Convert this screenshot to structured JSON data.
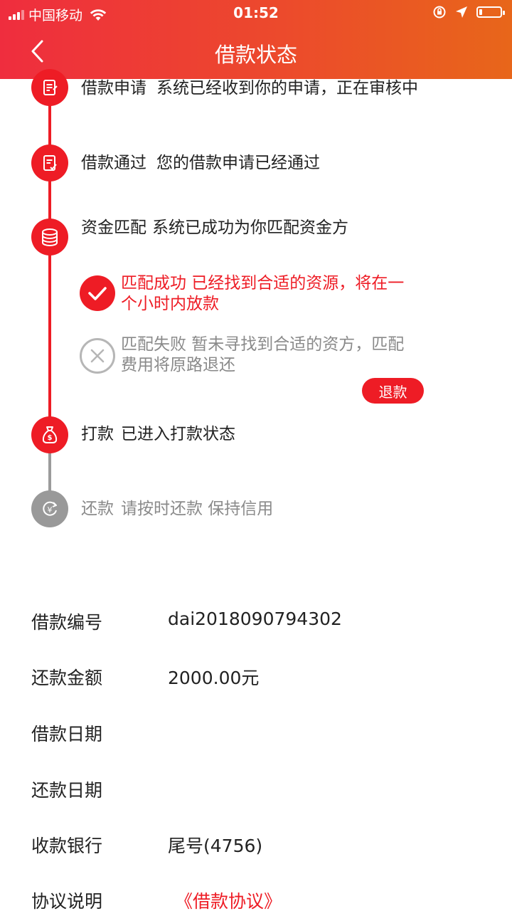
{
  "status_bar": {
    "carrier": "中国移动",
    "time": "01:52",
    "battery_percent": 15
  },
  "nav": {
    "title": "借款状态",
    "back_icon": "chevron-left-icon"
  },
  "colors": {
    "accent": "#ee1c25",
    "header_gradient_start": "#ef2d3e",
    "header_gradient_end": "#e8661a",
    "inactive": "#999999"
  },
  "timeline": [
    {
      "status": "借款申请",
      "desc": "系统已经收到你的申请，正在审核中",
      "icon": "application-form-icon",
      "active": true
    },
    {
      "status": "借款通过",
      "desc": "您的借款申请已经通过",
      "icon": "approved-document-icon",
      "active": true
    },
    {
      "status": "资金匹配",
      "desc": "系统已成功为你匹配资金方",
      "icon": "coins-stack-icon",
      "active": true
    },
    {
      "status": "打款",
      "desc": "已进入打款状态",
      "icon": "money-bag-icon",
      "active": true
    },
    {
      "status": "还款",
      "desc": "请按时还款 保持信用",
      "icon": "yuan-cycle-icon",
      "active": false
    }
  ],
  "match_results": {
    "success": {
      "text": "匹配成功 已经找到合适的资源，将在一个小时内放款",
      "icon": "check-circle-icon"
    },
    "fail": {
      "text": "匹配失败 暂未寻找到合适的资方，匹配费用将原路退还",
      "icon": "x-circle-icon"
    },
    "refund_button": "退款"
  },
  "info": {
    "loan_no": {
      "label": "借款编号",
      "value": "dai2018090794302"
    },
    "amount": {
      "label": "还款金额",
      "value": "2000.00元"
    },
    "loan_date": {
      "label": "借款日期",
      "value": ""
    },
    "repay_date": {
      "label": "还款日期",
      "value": ""
    },
    "bank": {
      "label": "收款银行",
      "value": "尾号(4756)"
    },
    "agreement": {
      "label": "协议说明",
      "value": "《借款协议》"
    }
  }
}
